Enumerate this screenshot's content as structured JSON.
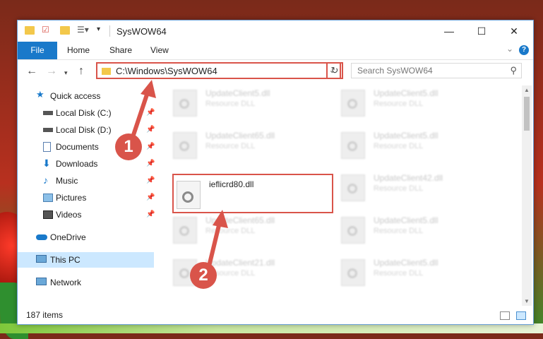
{
  "window": {
    "title": "SysWOW64",
    "controls": {
      "minimize": "—",
      "maximize": "☐",
      "close": "✕"
    }
  },
  "ribbon": {
    "file": "File",
    "tabs": [
      "Home",
      "Share",
      "View"
    ],
    "help": "?"
  },
  "navbar": {
    "address": "C:\\Windows\\SysWOW64",
    "search_placeholder": "Search SysWOW64"
  },
  "sidebar": {
    "items": [
      {
        "label": "Quick access",
        "icon": "star-icon",
        "pinned": false
      },
      {
        "label": "Local Disk (C:)",
        "icon": "drive-icon",
        "pinned": true
      },
      {
        "label": "Local Disk (D:)",
        "icon": "drive-icon",
        "pinned": true
      },
      {
        "label": "Documents",
        "icon": "documents-icon",
        "pinned": true
      },
      {
        "label": "Downloads",
        "icon": "download-icon",
        "pinned": true
      },
      {
        "label": "Music",
        "icon": "music-icon",
        "pinned": true
      },
      {
        "label": "Pictures",
        "icon": "pictures-icon",
        "pinned": true
      },
      {
        "label": "Videos",
        "icon": "videos-icon",
        "pinned": true
      },
      {
        "label": "OneDrive",
        "icon": "cloud-icon",
        "pinned": false
      },
      {
        "label": "This PC",
        "icon": "computer-icon",
        "pinned": false,
        "selected": true
      },
      {
        "label": "Network",
        "icon": "network-icon",
        "pinned": false
      }
    ]
  },
  "files": [
    {
      "name": "UpdateClient5.dll",
      "desc": "Resource DLL"
    },
    {
      "name": "UpdateClient5.dll",
      "desc": "Resource DLL"
    },
    {
      "name": "UpdateClient65.dll",
      "desc": "Resource DLL"
    },
    {
      "name": "UpdateClient5.dll",
      "desc": "Resource DLL"
    },
    {
      "name": "UpdateClient42.dll",
      "desc": "Resource DLL"
    },
    {
      "name": "UpdateClient65.dll",
      "desc": "Resource DLL"
    },
    {
      "name": "UpdateClient5.dll",
      "desc": "Resource DLL"
    },
    {
      "name": "UpdateClient21.dll",
      "desc": "Resource DLL"
    },
    {
      "name": "UpdateClient5.dll",
      "desc": "Resource DLL"
    }
  ],
  "highlighted_file": {
    "name": "ieflicrd80.dll"
  },
  "status": {
    "item_count": "187 items"
  },
  "annotations": {
    "step1": "1",
    "step2": "2"
  },
  "colors": {
    "accent": "#1979ca",
    "highlight": "#d9544a",
    "folder": "#f3c84b"
  }
}
